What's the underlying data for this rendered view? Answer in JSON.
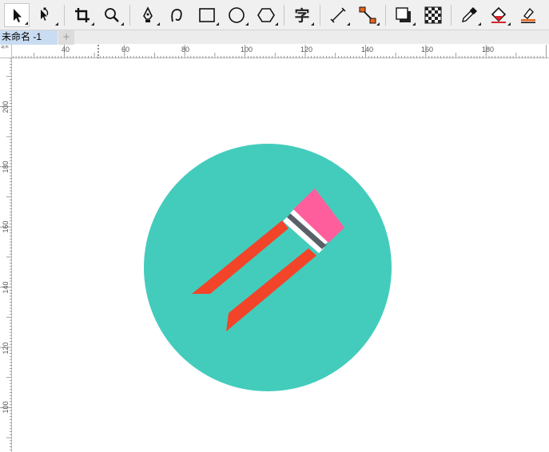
{
  "toolbar": {
    "tools": [
      {
        "name": "pick-tool",
        "icon": "arrow-pointer-icon"
      },
      {
        "name": "shape-tool",
        "icon": "node-edit-icon"
      },
      {
        "name": "crop-tool",
        "icon": "crop-icon"
      },
      {
        "name": "zoom-tool",
        "icon": "magnifier-icon"
      },
      {
        "name": "pen-tool",
        "icon": "pen-nib-icon"
      },
      {
        "name": "curve-tool",
        "icon": "curve-icon"
      },
      {
        "name": "rectangle-tool",
        "icon": "rectangle-icon"
      },
      {
        "name": "ellipse-tool",
        "icon": "ellipse-icon"
      },
      {
        "name": "polygon-tool",
        "icon": "hexagon-icon"
      },
      {
        "name": "text-tool",
        "icon": "text-glyph-icon",
        "glyph": "字"
      },
      {
        "name": "dimension-tool",
        "icon": "dimension-line-icon"
      },
      {
        "name": "connector-tool",
        "icon": "connector-icon"
      },
      {
        "name": "drop-shadow-tool",
        "icon": "shadow-icon"
      },
      {
        "name": "transparency-tool",
        "icon": "checkerboard-icon"
      },
      {
        "name": "eyedropper-tool",
        "icon": "eyedropper-icon"
      },
      {
        "name": "interactive-fill-tool",
        "icon": "fill-bucket-icon"
      },
      {
        "name": "smart-fill-tool",
        "icon": "smart-fill-icon"
      }
    ]
  },
  "tabs": {
    "document_title": "未命名 -1",
    "new_tab_label": "+"
  },
  "rulers": {
    "horizontal_labels": [
      "40",
      "60",
      "80",
      "100",
      "120",
      "140",
      "160",
      "180"
    ],
    "vertical_labels": [
      "200",
      "180",
      "160",
      "140",
      "120",
      "100"
    ],
    "unit_label": "毫米"
  },
  "artwork": {
    "circle_color": "#43ccbc",
    "pencil_body_color": "#f24429",
    "eraser_color": "#ff5e9c",
    "ferrule_color": "#5a6068",
    "band_color": "#ffffff"
  }
}
